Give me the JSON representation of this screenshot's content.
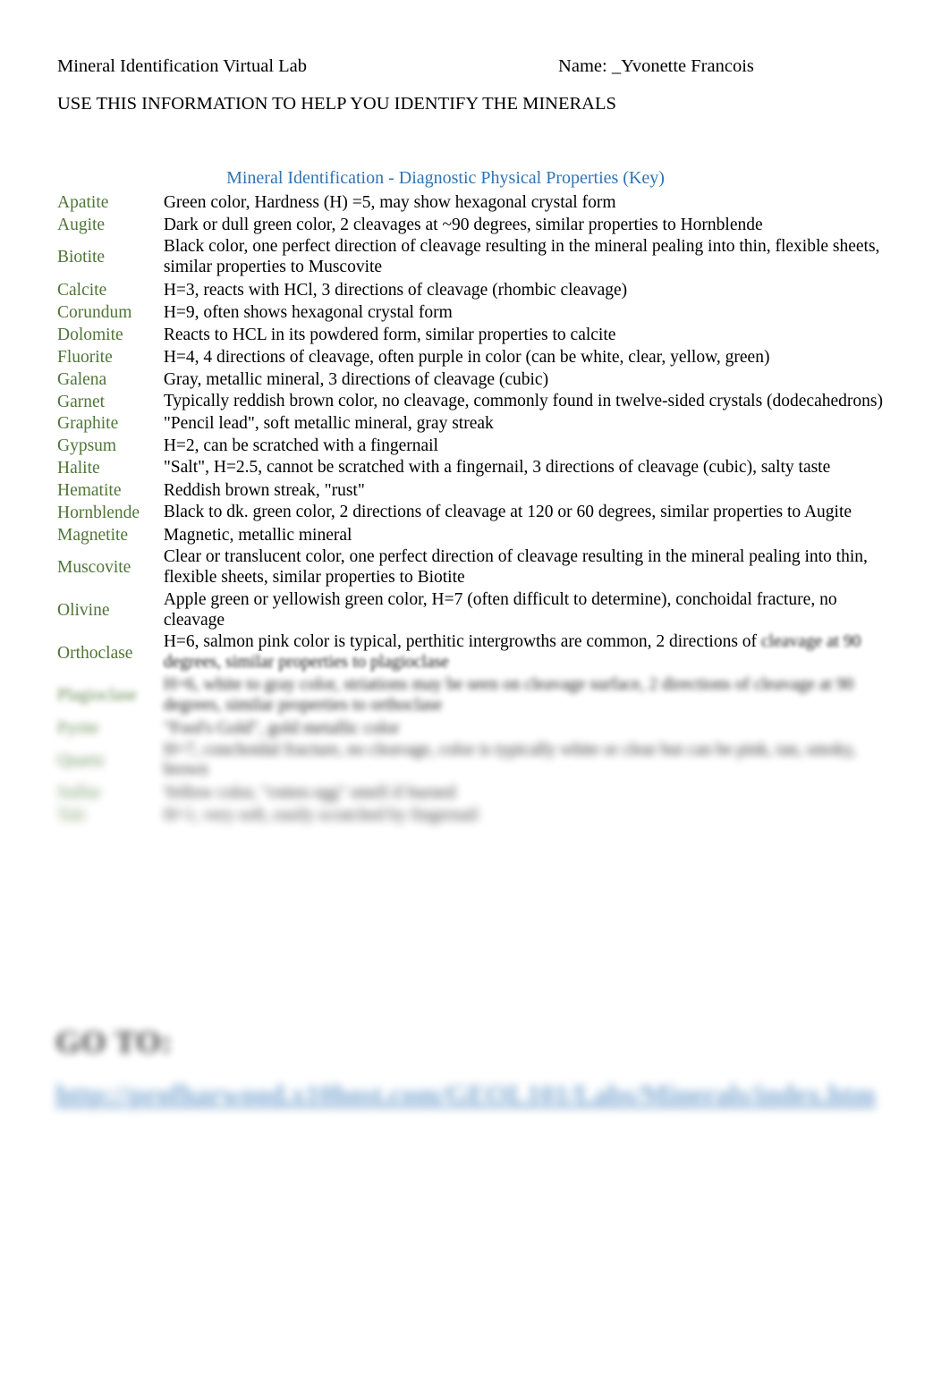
{
  "document": {
    "header_title": "Mineral Identification Virtual Lab",
    "header_name": "Name: _Yvonette Francois",
    "instruction": "USE THIS INFORMATION TO HELP YOU IDENTIFY THE MINERALS"
  },
  "table": {
    "title": "Mineral Identification - Diagnostic Physical Properties (Key)",
    "name_color": "#4F7536",
    "title_color": "#2E74B5",
    "rows": [
      {
        "name": "Apatite",
        "description": "Green color, Hardness (H) =5, may show hexagonal crystal form",
        "blur": 0
      },
      {
        "name": "Augite",
        "description": "Dark or dull green color, 2 cleavages at ~90 degrees, similar properties to Hornblende",
        "blur": 0
      },
      {
        "name": "Biotite",
        "description": "Black color, one perfect direction of cleavage resulting in the mineral pealing into thin, flexible sheets, similar properties to Muscovite",
        "blur": 0
      },
      {
        "name": "Calcite",
        "description": "H=3, reacts with HCl, 3 directions of cleavage (rhombic cleavage)",
        "blur": 0
      },
      {
        "name": "Corundum",
        "description": "H=9, often shows hexagonal crystal form",
        "blur": 0
      },
      {
        "name": "Dolomite",
        "description": "Reacts to HCL in its powdered form, similar properties to calcite",
        "blur": 0
      },
      {
        "name": "Fluorite",
        "description": "H=4, 4 directions of cleavage, often purple in color (can be white, clear, yellow, green)",
        "blur": 0
      },
      {
        "name": "Galena",
        "description": "Gray, metallic mineral, 3 directions of cleavage (cubic)",
        "blur": 0
      },
      {
        "name": "Garnet",
        "description": "Typically reddish brown color, no cleavage, commonly found in twelve-sided crystals (dodecahedrons)",
        "blur": 0
      },
      {
        "name": "Graphite",
        "description": "\"Pencil lead\", soft metallic mineral, gray streak",
        "blur": 0
      },
      {
        "name": "Gypsum",
        "description": "H=2, can be scratched with a fingernail",
        "blur": 0
      },
      {
        "name": "Halite",
        "description": "\"Salt\", H=2.5, cannot be scratched with a fingernail, 3 directions of cleavage (cubic), salty taste",
        "blur": 0
      },
      {
        "name": "Hematite",
        "description": "Reddish brown streak, \"rust\"",
        "blur": 0
      },
      {
        "name": "Hornblende",
        "description": "Black to dk. green color, 2 directions of cleavage at 120 or 60 degrees, similar properties to Augite",
        "blur": 0
      },
      {
        "name": "Magnetite",
        "description": "Magnetic, metallic mineral",
        "blur": 0
      },
      {
        "name": "Muscovite",
        "description": "Clear or translucent color, one perfect direction of cleavage resulting in the mineral pealing into thin, flexible sheets, similar properties to Biotite",
        "blur": 0
      },
      {
        "name": "Olivine",
        "description": "Apple green or yellowish green color, H=7 (often difficult to determine), conchoidal fracture, no cleavage",
        "blur": 0
      }
    ],
    "orthoclase_row": {
      "name": "Orthoclase",
      "line_clear": "H=6, salmon pink color is typical, perthitic intergrowths are common, 2 directions of",
      "line_blurred": "cleavage at 90 degrees, similar properties to plagioclase"
    },
    "blurred_rows": [
      {
        "name": "Plagioclase",
        "description": "H=6, white to gray color, striations may be seen on cleavage surface, 2 directions of cleavage at 90 degrees, similar properties to orthoclase",
        "blur_level": "blur-2"
      },
      {
        "name": "Pyrite",
        "description": "\"Fool's Gold\", gold metallic color",
        "blur_level": "blur-3"
      },
      {
        "name": "Quartz",
        "description": "H=7, conchoidal fracture, no cleavage, color is typically white or clear but can be pink, tan, smoky, brown",
        "blur_level": "blur-4"
      },
      {
        "name": "Sulfur",
        "description": "Yellow color, \"rotten egg\" smell if burned",
        "blur_level": "blur-5"
      },
      {
        "name": "Talc",
        "description": "H=1, very soft, easily scratched by fingernail",
        "blur_level": "blur-6"
      }
    ]
  },
  "goto_section": {
    "heading": "GO TO:",
    "link_text": "http://profharwood.x10host.com/GEOL101/Labs/Minerals/index.htm"
  }
}
